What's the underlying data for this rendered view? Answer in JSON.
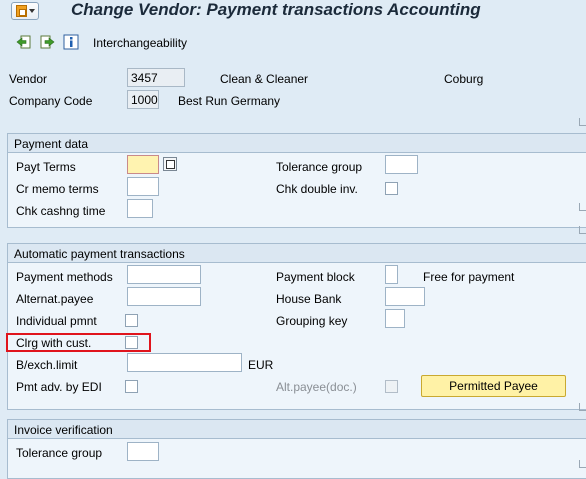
{
  "window": {
    "title": "Change Vendor: Payment transactions Accounting"
  },
  "toolbar": {
    "interchangeability_label": "Interchangeability"
  },
  "header": {
    "vendor_label": "Vendor",
    "vendor_value": "3457",
    "vendor_name": "Clean & Cleaner",
    "vendor_city": "Coburg",
    "company_code_label": "Company Code",
    "company_code_value": "1000",
    "company_name": "Best Run Germany"
  },
  "payment_data": {
    "title": "Payment data",
    "payt_terms_label": "Payt Terms",
    "payt_terms_value": "",
    "tolerance_group_label": "Tolerance group",
    "tolerance_group_value": "",
    "cr_memo_terms_label": "Cr memo terms",
    "cr_memo_terms_value": "",
    "chk_double_inv_label": "Chk double inv.",
    "chk_cashng_time_label": "Chk cashng time",
    "chk_cashng_time_value": ""
  },
  "auto_payment": {
    "title": "Automatic payment transactions",
    "payment_methods_label": "Payment methods",
    "payment_methods_value": "",
    "payment_block_label": "Payment block",
    "payment_block_value": "",
    "payment_block_text": "Free for payment",
    "alternat_payee_label": "Alternat.payee",
    "alternat_payee_value": "",
    "house_bank_label": "House Bank",
    "house_bank_value": "",
    "individual_pmnt_label": "Individual pmnt",
    "grouping_key_label": "Grouping key",
    "grouping_key_value": "",
    "clrg_with_cust_label": "Clrg with cust.",
    "bexch_limit_label": "B/exch.limit",
    "bexch_limit_value": "",
    "bexch_currency": "EUR",
    "pmt_adv_edi_label": "Pmt adv. by EDI",
    "alt_payee_doc_label": "Alt.payee(doc.)",
    "permitted_payee_button": "Permitted Payee"
  },
  "invoice_verification": {
    "title": "Invoice verification",
    "tolerance_group_label": "Tolerance group",
    "tolerance_group_value": ""
  },
  "icons": {
    "app": "menu-app-icon",
    "prev": "previous-screen-icon",
    "next": "next-screen-icon",
    "info": "info-icon",
    "search_help": "search-help-icon"
  },
  "colors": {
    "background": "#dfebf5",
    "focus_field": "#fff3b0",
    "highlight_box": "#e0141c",
    "button": "#fff2a6"
  }
}
